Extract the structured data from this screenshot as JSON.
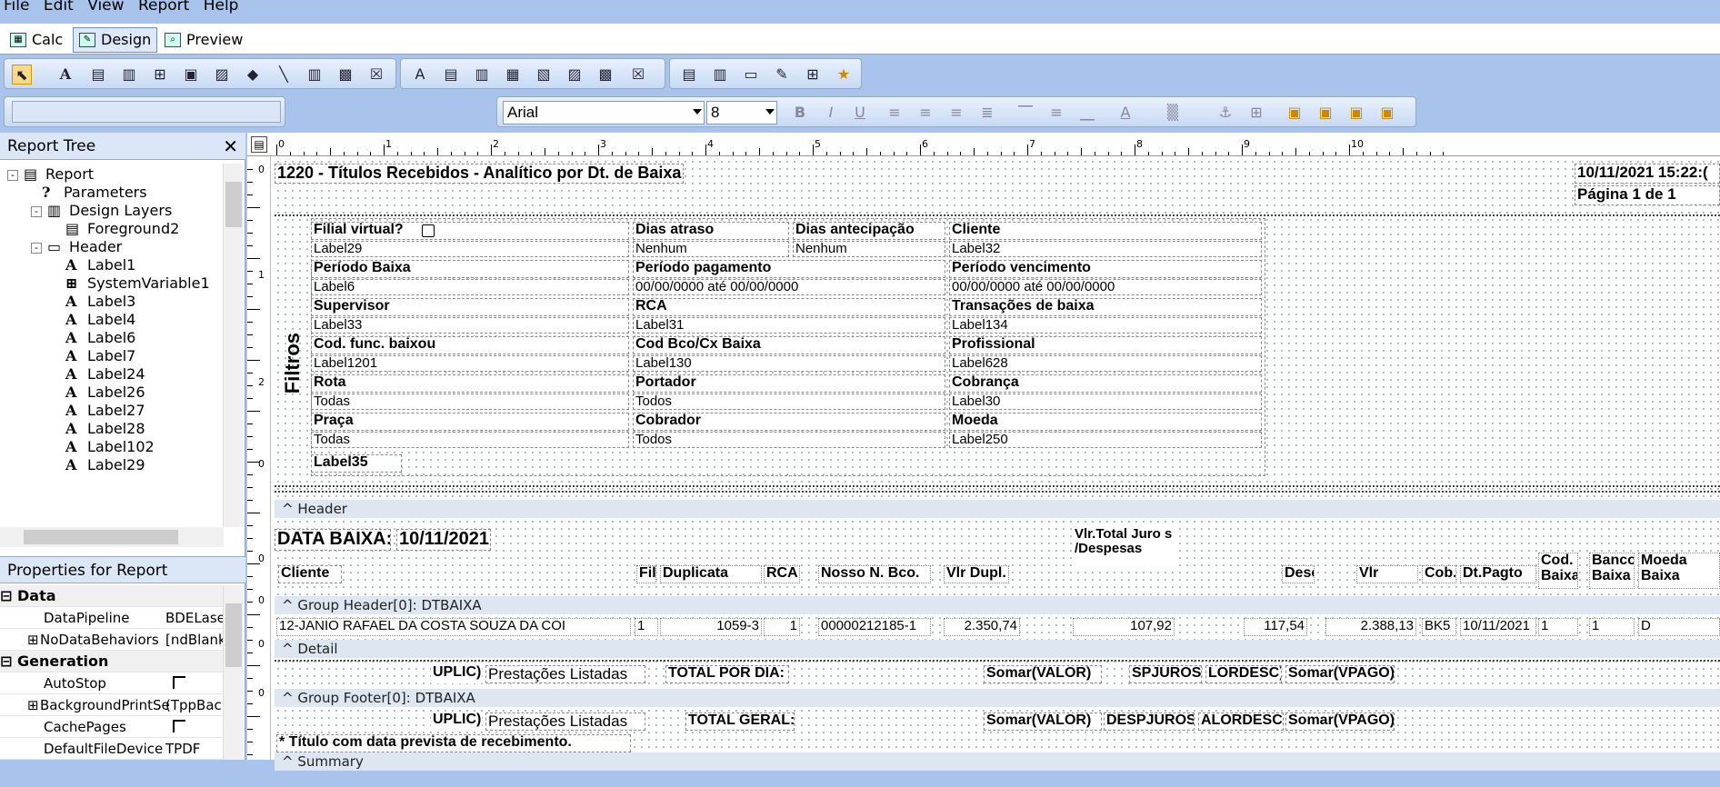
{
  "menu": [
    "File",
    "Edit",
    "View",
    "Report",
    "Help"
  ],
  "tabs": [
    {
      "label": "Calc"
    },
    {
      "label": "Design"
    },
    {
      "label": "Preview"
    }
  ],
  "font": {
    "name": "Arial",
    "size": "8"
  },
  "tree_title": "Report Tree",
  "tree": [
    {
      "label": "Report",
      "icon": "report-icon",
      "level": 0,
      "exp": "-"
    },
    {
      "label": "Parameters",
      "icon": "parameters-icon",
      "level": 1
    },
    {
      "label": "Design Layers",
      "icon": "layers-icon",
      "level": 1,
      "exp": "-"
    },
    {
      "label": "Foreground2",
      "icon": "layer-icon",
      "level": 2
    },
    {
      "label": "Header",
      "icon": "band-icon",
      "level": 1,
      "exp": "-"
    },
    {
      "label": "Label1",
      "icon": "label-icon",
      "level": 2
    },
    {
      "label": "SystemVariable1",
      "icon": "system-variable-icon",
      "level": 2
    },
    {
      "label": "Label3",
      "icon": "label-icon",
      "level": 2
    },
    {
      "label": "Label4",
      "icon": "label-icon",
      "level": 2
    },
    {
      "label": "Label6",
      "icon": "label-icon",
      "level": 2
    },
    {
      "label": "Label7",
      "icon": "label-icon",
      "level": 2
    },
    {
      "label": "Label24",
      "icon": "label-icon",
      "level": 2
    },
    {
      "label": "Label26",
      "icon": "label-icon",
      "level": 2
    },
    {
      "label": "Label27",
      "icon": "label-icon",
      "level": 2
    },
    {
      "label": "Label28",
      "icon": "label-icon",
      "level": 2
    },
    {
      "label": "Label102",
      "icon": "label-icon",
      "level": 2
    },
    {
      "label": "Label29",
      "icon": "label-icon",
      "level": 2
    }
  ],
  "props_title": "Properties for Report",
  "props": [
    {
      "cat": "Data"
    },
    {
      "name": "DataPipeline",
      "value": "BDELase"
    },
    {
      "name": "NoDataBehaviors",
      "value": "[ndBlank",
      "plus": true
    },
    {
      "cat": "Generation"
    },
    {
      "name": "AutoStop",
      "check": true
    },
    {
      "name": "BackgroundPrintSe",
      "value": "(TppBac",
      "plus": true
    },
    {
      "name": "CachePages",
      "check": true
    },
    {
      "name": "DefaultFileDevice",
      "value": "TPDF"
    }
  ],
  "ruler": [
    "0",
    "1",
    "2",
    "3",
    "4",
    "5",
    "6",
    "7",
    "8",
    "9",
    "10"
  ],
  "vruler": [
    "0",
    "1",
    "2",
    "0",
    "0",
    "0",
    "0",
    "0"
  ],
  "header": {
    "title": "1220 - Títulos Recebidos - Analítico por Dt. de Baixa",
    "datetime": "10/11/2021 15:22:(",
    "page": "Página 1 de 1",
    "filtros": "Filtros",
    "filters": [
      {
        "cols": [
          {
            "label": "Filial virtual?",
            "value": "Label29",
            "check": true
          },
          {
            "label": "Dias atraso",
            "value": "Nenhum"
          },
          {
            "label": "Dias antecipação",
            "value": "Nenhum"
          },
          {
            "label": "Cliente",
            "value": "Label32"
          }
        ]
      },
      {
        "cols": [
          {
            "label": "Período Baixa",
            "value": "Label6"
          },
          {
            "label": "Período pagamento",
            "value": "00/00/0000  até  00/00/0000"
          },
          {
            "label": "Período vencimento",
            "value": "00/00/0000  até  00/00/0000"
          }
        ]
      },
      {
        "cols": [
          {
            "label": "Supervisor",
            "value": "Label33"
          },
          {
            "label": "RCA",
            "value": "Label31"
          },
          {
            "label": "Transações de baixa",
            "value": "Label134"
          }
        ]
      },
      {
        "cols": [
          {
            "label": "Cod. func. baixou",
            "value": "Label1201"
          },
          {
            "label": "Cod Bco/Cx Baixa",
            "value": "Label130"
          },
          {
            "label": "Profissional",
            "value": "Label628"
          }
        ]
      },
      {
        "cols": [
          {
            "label": "Rota",
            "value": "Todas"
          },
          {
            "label": "Portador",
            "value": "Todos"
          },
          {
            "label": "Cobrança",
            "value": "Label30"
          }
        ]
      },
      {
        "cols": [
          {
            "label": "Praça",
            "value": "Todas"
          },
          {
            "label": "Cobrador",
            "value": "Todos"
          },
          {
            "label": "Moeda",
            "value": "Label250"
          }
        ]
      }
    ],
    "label35": "Label35"
  },
  "bands": {
    "header": "Header",
    "group_header": "Group Header[0]: DTBAIXA",
    "detail": "Detail",
    "group_footer": "Group Footer[0]: DTBAIXA",
    "summary": "Summary"
  },
  "group": {
    "data_baixa_label": "DATA BAIXA:",
    "data_baixa_value": "10/11/2021",
    "juros_header": "Vlr.Total Juro s /Despesas",
    "cols": [
      "Cliente",
      "Fil.",
      "Duplicata",
      "RCA",
      "Nosso N. Bco.",
      "Vlr Dupl.",
      "Desc.",
      "Vlr Pago",
      "Cob.",
      "Dt.Pagto",
      "Cod. Baixa",
      "Banco Baixa",
      "Moeda Baixa"
    ]
  },
  "detail": [
    "12-JANIO RAFAEL DA COSTA SOUZA DA COI",
    "1",
    "1059-3",
    "1",
    "00000212185-1",
    "2.350,74",
    "107,92",
    "117,54",
    "2.388,13",
    "BK5",
    "10/11/2021",
    "1",
    "1",
    "D"
  ],
  "footer": {
    "uplic": "UPLIC)",
    "prest": "Prestações Listadas",
    "total": "TOTAL POR DIA:",
    "valor": "Somar(VALOR)",
    "juros": "SPJUROS)",
    "desc": "LORDESC)",
    "pago": "Somar(VPAGO)"
  },
  "summary": {
    "uplic": "UPLIC)",
    "prest": "Prestações Listadas",
    "total": "TOTAL GERAL:",
    "valor": "Somar(VALOR)",
    "juros": "DESPJUROS)",
    "desc": "ALORDESC)",
    "pago": "Somar(VPAGO)",
    "note": "* Título com data prevista de recebimento."
  }
}
